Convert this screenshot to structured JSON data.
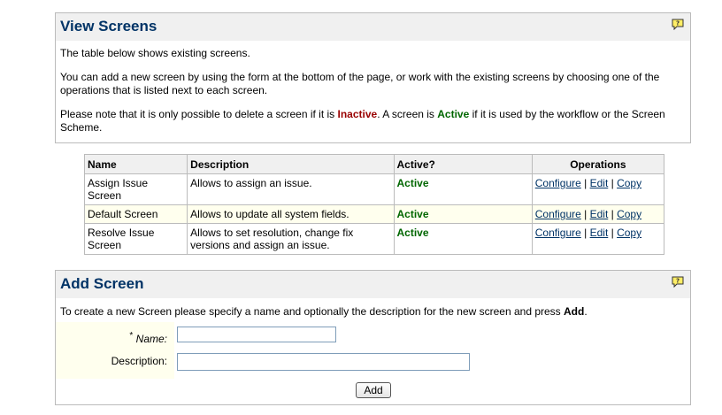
{
  "view_panel": {
    "title": "View Screens",
    "intro": "The table below shows existing screens.",
    "instructions": "You can add a new screen by using the form at the bottom of the page, or work with the existing screens by choosing one of the operations that is listed next to each screen.",
    "note_prefix": "Please note that it is only possible to delete a screen if it is ",
    "inactive_word": "Inactive",
    "note_middle": ". A screen is ",
    "active_word": "Active",
    "note_suffix": " if it is used by the workflow or the Screen Scheme.",
    "help_icon": "help-icon"
  },
  "screens_table": {
    "headers": {
      "name": "Name",
      "description": "Description",
      "active": "Active?",
      "operations": "Operations"
    },
    "rows": [
      {
        "name": "Assign Issue Screen",
        "description": "Allows to assign an issue.",
        "active": "Active",
        "ops": {
          "configure": "Configure",
          "edit": "Edit",
          "copy": "Copy",
          "sep": "|"
        }
      },
      {
        "name": "Default Screen",
        "description": "Allows to update all system fields.",
        "active": "Active",
        "ops": {
          "configure": "Configure",
          "edit": "Edit",
          "copy": "Copy",
          "sep": "|"
        }
      },
      {
        "name": "Resolve Issue Screen",
        "description": "Allows to set resolution, change fix versions and assign an issue.",
        "active": "Active",
        "ops": {
          "configure": "Configure",
          "edit": "Edit",
          "copy": "Copy",
          "sep": "|"
        }
      }
    ]
  },
  "add_panel": {
    "title": "Add Screen",
    "intro_prefix": "To create a new Screen please specify a name and optionally the description for the new screen and press ",
    "intro_bold": "Add",
    "intro_suffix": ".",
    "name_required_mark": "*",
    "name_label": "Name:",
    "name_value": "",
    "description_label": "Description:",
    "description_value": "",
    "add_button": "Add",
    "help_icon": "help-icon"
  },
  "colors": {
    "title": "#003366",
    "active": "#006600",
    "inactive": "#990000",
    "header_bg": "#f0f0f0",
    "highlight_row": "#ffffee"
  }
}
